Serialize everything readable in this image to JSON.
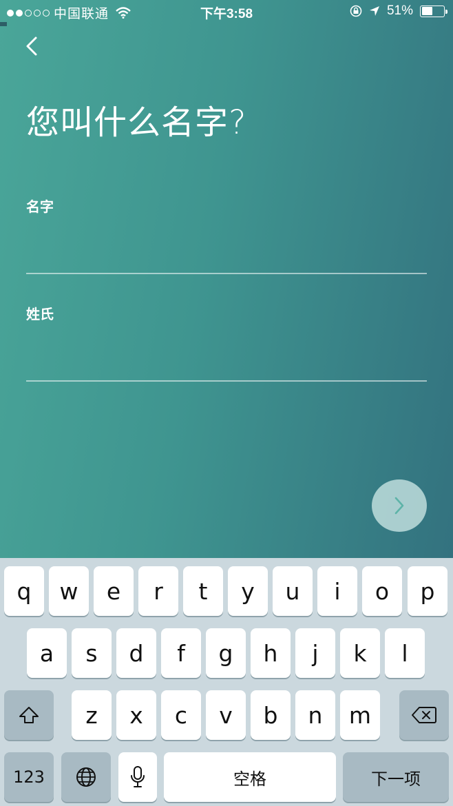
{
  "status_bar": {
    "carrier": "中国联通",
    "time": "下午3:58",
    "battery": "51%",
    "battery_level": 0.51
  },
  "header": {
    "back_icon": "chevron-left-icon",
    "title": "您叫什么名字?"
  },
  "form": {
    "first_name": {
      "label": "名字",
      "value": ""
    },
    "last_name": {
      "label": "姓氏",
      "value": ""
    }
  },
  "next_button": {
    "icon": "chevron-right-icon"
  },
  "keyboard": {
    "row1": [
      "q",
      "w",
      "e",
      "r",
      "t",
      "y",
      "u",
      "i",
      "o",
      "p"
    ],
    "row2": [
      "a",
      "s",
      "d",
      "f",
      "g",
      "h",
      "j",
      "k",
      "l"
    ],
    "row3": [
      "z",
      "x",
      "c",
      "v",
      "b",
      "n",
      "m"
    ],
    "numbers_label": "123",
    "space_label": "空格",
    "return_label": "下一项",
    "shift_icon": "shift-icon",
    "delete_icon": "backspace-icon",
    "globe_icon": "globe-icon",
    "mic_icon": "microphone-icon"
  },
  "colors": {
    "gradient_start": "#4aa699",
    "gradient_end": "#33727f",
    "keyboard_bg": "#cbd8de",
    "function_key": "#a8bac3"
  }
}
